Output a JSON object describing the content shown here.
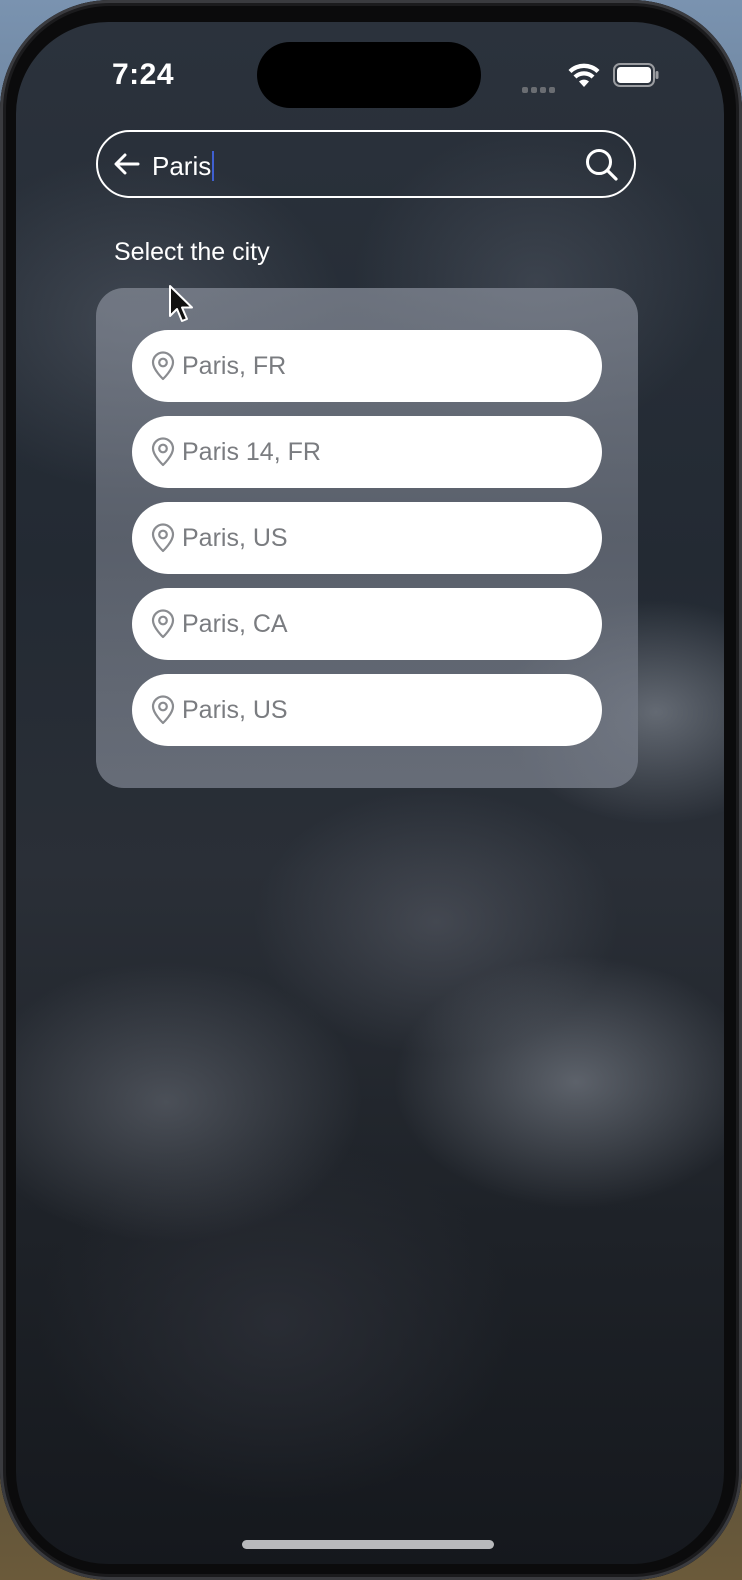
{
  "status_bar": {
    "time": "7:24",
    "signal_icon": "cellular-signal-icon",
    "wifi_icon": "wifi-icon",
    "battery_icon": "battery-icon"
  },
  "search": {
    "query": "Paris",
    "back_icon": "arrow-left-icon",
    "search_icon": "magnifier-icon"
  },
  "results": {
    "heading": "Select the city",
    "items": [
      {
        "label": "Paris, FR",
        "icon": "location-pin-icon"
      },
      {
        "label": "Paris 14, FR",
        "icon": "location-pin-icon"
      },
      {
        "label": "Paris, US",
        "icon": "location-pin-icon"
      },
      {
        "label": "Paris, CA",
        "icon": "location-pin-icon"
      },
      {
        "label": "Paris, US",
        "icon": "location-pin-icon"
      }
    ]
  },
  "colors": {
    "text_primary": "#ffffff",
    "item_text": "#7a7c80",
    "item_background": "#ffffff",
    "caret": "#3f5fd0"
  }
}
